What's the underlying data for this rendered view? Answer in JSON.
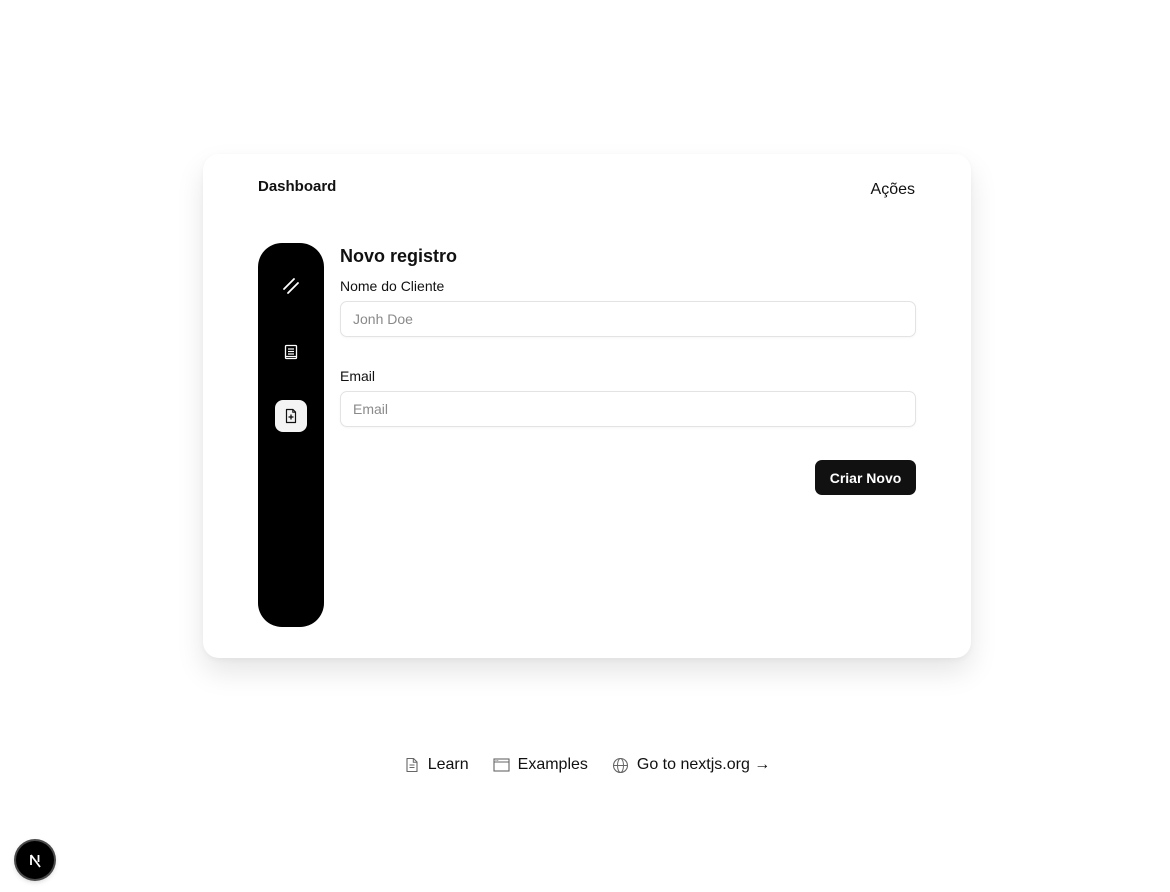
{
  "card": {
    "title": "Dashboard",
    "actions_label": "Ações"
  },
  "sidebar": {
    "items": [
      {
        "icon": "slash-icon",
        "active": false
      },
      {
        "icon": "notebook-icon",
        "active": false
      },
      {
        "icon": "file-plus-icon",
        "active": true
      }
    ]
  },
  "form": {
    "heading": "Novo registro",
    "name_label": "Nome do Cliente",
    "name_placeholder": "Jonh Doe",
    "email_label": "Email",
    "email_placeholder": "Email",
    "submit_label": "Criar Novo"
  },
  "footer": {
    "learn_label": "Learn",
    "examples_label": "Examples",
    "nextjs_label": "Go to nextjs.org →"
  },
  "colors": {
    "rail_background": "#000000",
    "button_background": "#111111",
    "active_item_background": "#f4f4f4"
  }
}
